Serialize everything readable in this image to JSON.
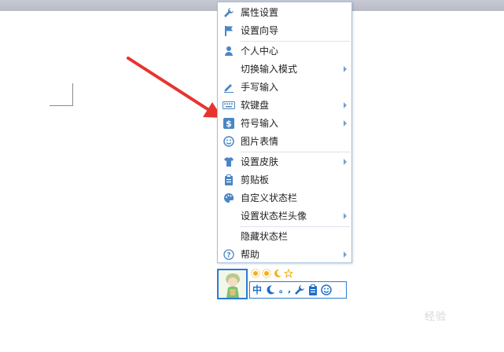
{
  "menu": {
    "items": [
      {
        "label": "属性设置",
        "icon": "wrench-icon",
        "submenu": false
      },
      {
        "label": "设置向导",
        "icon": "flag-icon",
        "submenu": false
      },
      {
        "label": "个人中心",
        "icon": "user-icon",
        "submenu": false
      },
      {
        "label": "切换输入模式",
        "icon": "",
        "submenu": true
      },
      {
        "label": "手写输入",
        "icon": "pen-icon",
        "submenu": false
      },
      {
        "label": "软键盘",
        "icon": "keyboard-icon",
        "submenu": true
      },
      {
        "label": "符号输入",
        "icon": "dollar-icon",
        "submenu": true
      },
      {
        "label": "图片表情",
        "icon": "smiley-icon",
        "submenu": false
      },
      {
        "label": "设置皮肤",
        "icon": "shirt-icon",
        "submenu": true
      },
      {
        "label": "剪贴板",
        "icon": "clipboard-icon",
        "submenu": false
      },
      {
        "label": "自定义状态栏",
        "icon": "palette-icon",
        "submenu": false
      },
      {
        "label": "设置状态栏头像",
        "icon": "",
        "submenu": true
      },
      {
        "label": "隐藏状态栏",
        "icon": "",
        "submenu": false
      },
      {
        "label": "帮助",
        "icon": "help-icon",
        "submenu": true
      }
    ]
  },
  "status_bar": {
    "mode_label": "中",
    "punct_label": "。,",
    "top_icons": [
      "sun-icon",
      "sun-icon",
      "moon-icon",
      "star-icon"
    ],
    "icons": [
      "moon-icon",
      "punctuation-icon",
      "wrench-icon",
      "clipboard-icon",
      "smiley-icon"
    ]
  },
  "watermark": "经验",
  "colors": {
    "icon_blue": "#4a86c5",
    "accent": "#2a7bd4",
    "arrow_red": "#e8342f",
    "gold": "#f0b020"
  }
}
